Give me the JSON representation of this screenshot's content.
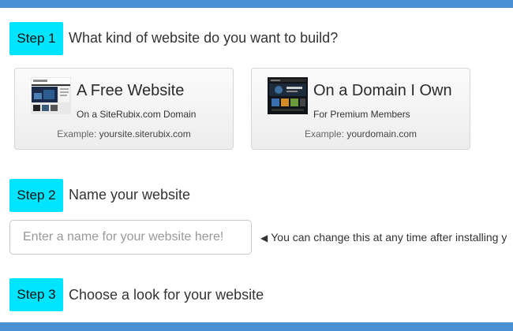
{
  "steps": {
    "step1": {
      "badge": "Step 1",
      "title": "What kind of website do you want to build?",
      "options": [
        {
          "title": "A Free Website",
          "subtitle": "On a SiteRubix.com Domain",
          "example_label": "Example:",
          "example_value": "yoursite.siterubix.com",
          "icon": "free-site-thumbnail-icon"
        },
        {
          "title": "On a Domain I Own",
          "subtitle": "For Premium Members",
          "example_label": "Example:",
          "example_value": "yourdomain.com",
          "icon": "domain-site-thumbnail-icon"
        }
      ]
    },
    "step2": {
      "badge": "Step 2",
      "title": "Name your website",
      "input_placeholder": "Enter a name for your website here!",
      "input_value": "",
      "hint": "You can change this at any time after installing y"
    },
    "step3": {
      "badge": "Step 3",
      "title": "Choose a look for your website"
    }
  },
  "colors": {
    "accent_bar": "#4a90d2",
    "step_badge": "#00e5ff"
  }
}
